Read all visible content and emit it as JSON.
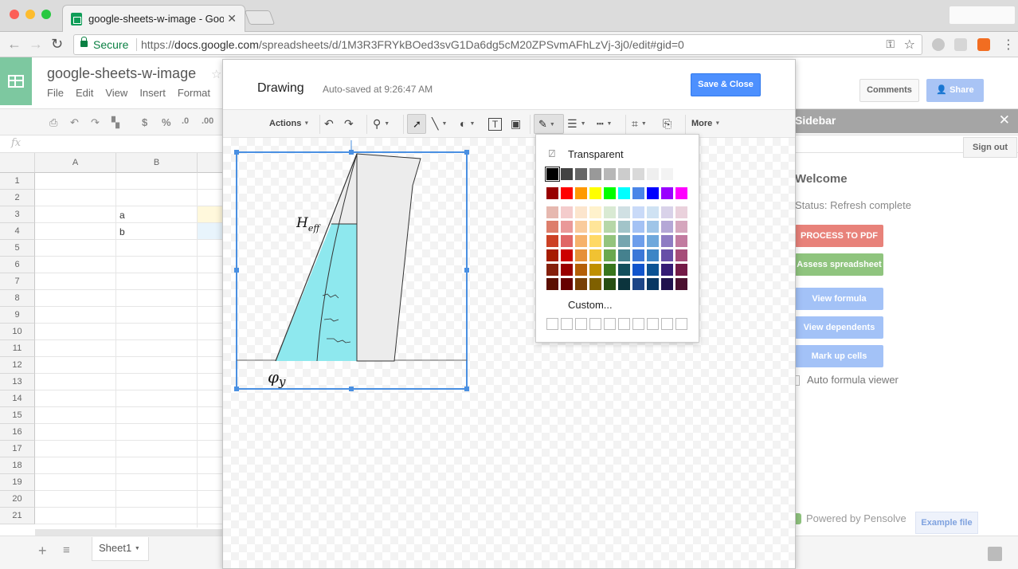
{
  "browser": {
    "tab_title": "google-sheets-w-image - Goo",
    "tab_close": "✕",
    "secure_label": "Secure",
    "url_scheme": "https://",
    "url_host": "docs.google.com",
    "url_path": "/spreadsheets/d/1M3R3FRYkBOed3svG1Da6dg5cM20ZPSvmAFhLzVj-3j0/edit#gid=0"
  },
  "sheets": {
    "doc_title": "google-sheets-w-image",
    "menu": [
      "File",
      "Edit",
      "View",
      "Insert",
      "Format"
    ],
    "toolbar": {
      "currency": "$",
      "percent": "%",
      "decimal_less": ".0",
      "decimal_more": ".00"
    },
    "fx": "fx",
    "columns": [
      "A",
      "B"
    ],
    "rows": [
      "1",
      "2",
      "3",
      "4",
      "5",
      "6",
      "7",
      "8",
      "9",
      "10",
      "11",
      "12",
      "13",
      "14",
      "15",
      "16",
      "17",
      "18",
      "19",
      "20",
      "21"
    ],
    "cells": {
      "B3": "a",
      "B4": "b"
    },
    "sheet_tab": "Sheet1"
  },
  "header_buttons": {
    "comments": "Comments",
    "share": "Share"
  },
  "sidebar": {
    "title": "Sidebar",
    "close": "✕",
    "sign_out": "Sign out",
    "welcome": "Welcome",
    "status": "Status: Refresh complete",
    "buttons": [
      {
        "label": "PROCESS TO PDF",
        "color": "#e8827a"
      },
      {
        "label": "Assess spreadsheet",
        "color": "#8fc47e"
      },
      {
        "label": "View formula",
        "color": "#a3c2f7"
      },
      {
        "label": "View dependents",
        "color": "#a3c2f7"
      },
      {
        "label": "Mark up cells",
        "color": "#a3c2f7"
      }
    ],
    "auto_formula": "Auto formula viewer",
    "powered_by": "Powered by Pensolve",
    "example_file": "Example file"
  },
  "drawing": {
    "title": "Drawing",
    "autosaved": "Auto-saved at 9:26:47 AM",
    "save_close": "Save & Close",
    "toolbar": {
      "actions": "Actions",
      "more": "More"
    },
    "image_labels": {
      "h": "H",
      "eff": "eff",
      "phi": "φ",
      "y": "y"
    }
  },
  "color_popup": {
    "transparent": "Transparent",
    "custom": "Custom...",
    "grays": [
      "#000000",
      "#434343",
      "#666666",
      "#999999",
      "#b7b7b7",
      "#cccccc",
      "#d9d9d9",
      "#efefef",
      "#f3f3f3",
      "#ffffff"
    ],
    "brights": [
      "#980000",
      "#ff0000",
      "#ff9900",
      "#ffff00",
      "#00ff00",
      "#00ffff",
      "#4a86e8",
      "#0000ff",
      "#9900ff",
      "#ff00ff"
    ],
    "shades": [
      [
        "#e6b8af",
        "#f4cccc",
        "#fce5cd",
        "#fff2cc",
        "#d9ead3",
        "#d0e0e3",
        "#c9daf8",
        "#cfe2f3",
        "#d9d2e9",
        "#ead1dc"
      ],
      [
        "#dd7e6b",
        "#ea9999",
        "#f9cb9c",
        "#ffe599",
        "#b6d7a8",
        "#a2c4c9",
        "#a4c2f4",
        "#9fc5e8",
        "#b4a7d6",
        "#d5a6bd"
      ],
      [
        "#cc4125",
        "#e06666",
        "#f6b26b",
        "#ffd966",
        "#93c47d",
        "#76a5af",
        "#6d9eeb",
        "#6fa8dc",
        "#8e7cc3",
        "#c27ba0"
      ],
      [
        "#a61c00",
        "#cc0000",
        "#e69138",
        "#f1c232",
        "#6aa84f",
        "#45818e",
        "#3c78d8",
        "#3d85c6",
        "#674ea7",
        "#a64d79"
      ],
      [
        "#85200c",
        "#990000",
        "#b45f06",
        "#bf9000",
        "#38761d",
        "#134f5c",
        "#1155cc",
        "#0b5394",
        "#351c75",
        "#741b47"
      ],
      [
        "#5b0f00",
        "#660000",
        "#783f04",
        "#7f6000",
        "#274e13",
        "#0c343d",
        "#1c4587",
        "#073763",
        "#20124d",
        "#4c1130"
      ]
    ],
    "custom_slots": 10
  }
}
